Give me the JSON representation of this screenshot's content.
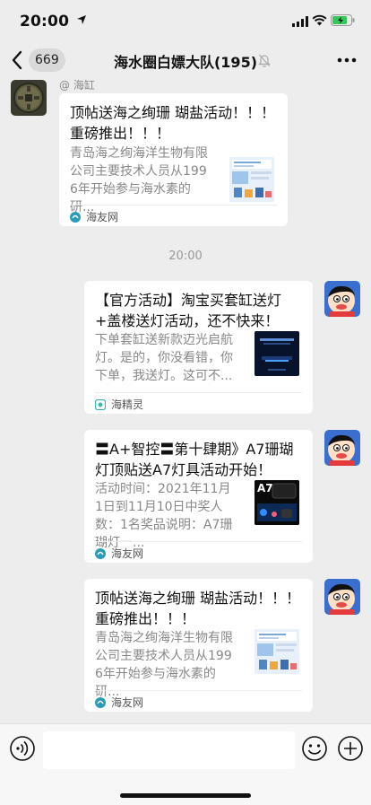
{
  "status_bar": {
    "time": "20:00"
  },
  "nav": {
    "unread_count": "669",
    "title": "海水圈白嫖大队(195)"
  },
  "messages": [
    {
      "sender": "@ 海缸",
      "title": "顶帖送海之绚珊 瑚盐活动！！！ 重磅推出！！！",
      "desc": "青岛海之绚海洋生物有限公司主要技术人员从1996年开始参与海水素的研...",
      "source": "海友网"
    },
    {
      "title": "【官方活动】淘宝买套缸送灯+盖楼送灯活动，还不快来！",
      "desc": "下单套缸送新款迈光启航灯。是的，你没看错，你下单，我送灯。这可不...",
      "source": "海精灵"
    },
    {
      "title": "〓A+智控〓第十肆期》A7珊瑚灯顶贴送A7灯具活动开始！",
      "desc": "活动时间：2021年11月1日到11月10日中奖人数：1名奖品说明：A7珊瑚灯一...",
      "thumb_label": "A7",
      "source": "海友网"
    },
    {
      "title": "顶帖送海之绚珊 瑚盐活动！！！ 重磅推出！！！",
      "desc": "青岛海之绚海洋生物有限公司主要技术人员从1996年开始参与海水素的研...",
      "source": "海友网"
    }
  ],
  "timestamp": "20:00",
  "colors": {
    "background": "#ededed",
    "card": "#ffffff",
    "accent_badge": "#d9d9d9",
    "source_teal": "#2a9bb8"
  }
}
